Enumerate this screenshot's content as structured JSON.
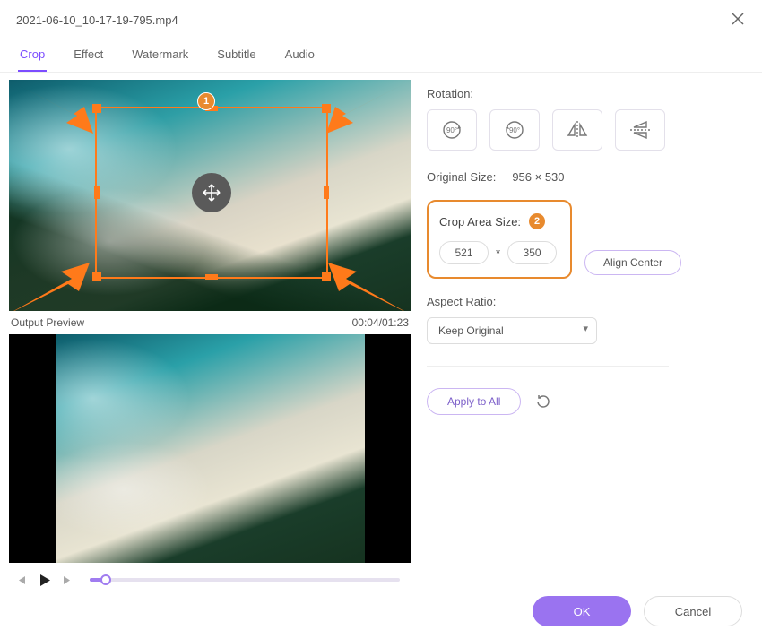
{
  "titlebar": {
    "filename": "2021-06-10_10-17-19-795.mp4"
  },
  "tabs": {
    "crop": "Crop",
    "effect": "Effect",
    "watermark": "Watermark",
    "subtitle": "Subtitle",
    "audio": "Audio"
  },
  "preview": {
    "output_label": "Output Preview",
    "time": "00:04/01:23",
    "annotations": {
      "badge1": "1",
      "badge2": "2"
    }
  },
  "rotation": {
    "label": "Rotation:"
  },
  "original_size": {
    "label": "Original Size:",
    "value": "956 × 530"
  },
  "crop_area": {
    "label": "Crop Area Size:",
    "width": "521",
    "separator": "*",
    "height": "350",
    "align_center": "Align Center"
  },
  "aspect_ratio": {
    "label": "Aspect Ratio:",
    "value": "Keep Original"
  },
  "actions": {
    "apply_all": "Apply to All"
  },
  "footer": {
    "ok": "OK",
    "cancel": "Cancel"
  }
}
